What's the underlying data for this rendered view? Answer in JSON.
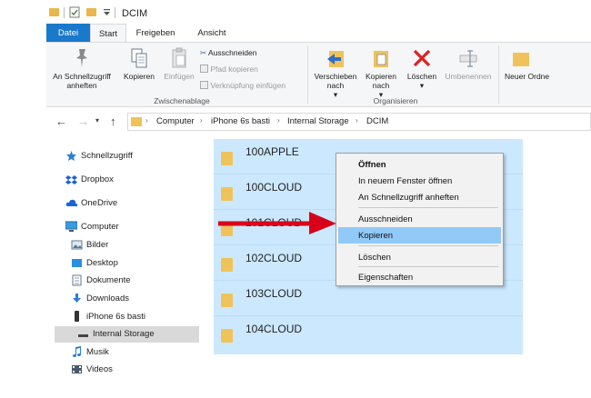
{
  "window": {
    "title": "DCIM"
  },
  "ribbon": {
    "tabs": [
      "Datei",
      "Start",
      "Freigeben",
      "Ansicht"
    ],
    "clipboard": {
      "pin_quick_access": "An Schnellzugriff anheften",
      "copy": "Kopieren",
      "paste": "Einfügen",
      "cut": "Ausschneiden",
      "copy_path": "Pfad kopieren",
      "paste_shortcut": "Verknüpfung einfügen",
      "group_label": "Zwischenablage"
    },
    "organize": {
      "move_to": "Verschieben nach",
      "copy_to": "Kopieren nach",
      "delete": "Löschen",
      "rename": "Umbenennen",
      "group_label": "Organisieren"
    },
    "new": {
      "new_folder": "Neuer Ordne"
    }
  },
  "address": {
    "crumbs": [
      "Computer",
      "iPhone 6s basti",
      "Internal Storage",
      "DCIM"
    ]
  },
  "sidebar": {
    "items": [
      {
        "label": "Schnellzugriff",
        "icon": "star-icon"
      },
      {
        "label": "Dropbox",
        "icon": "dropbox-icon"
      },
      {
        "label": "OneDrive",
        "icon": "cloud-icon"
      },
      {
        "label": "Computer",
        "icon": "monitor-icon"
      },
      {
        "label": "Bilder",
        "icon": "pictures-icon"
      },
      {
        "label": "Desktop",
        "icon": "desktop-icon"
      },
      {
        "label": "Dokumente",
        "icon": "documents-icon"
      },
      {
        "label": "Downloads",
        "icon": "download-icon"
      },
      {
        "label": "iPhone 6s basti",
        "icon": "phone-icon"
      },
      {
        "label": "Internal Storage",
        "icon": "drive-icon"
      },
      {
        "label": "Musik",
        "icon": "music-icon"
      },
      {
        "label": "Videos",
        "icon": "video-icon"
      }
    ]
  },
  "folders": [
    "100APPLE",
    "100CLOUD",
    "101CLOUD",
    "102CLOUD",
    "103CLOUD",
    "104CLOUD"
  ],
  "context_menu": {
    "open": "Öffnen",
    "open_new_window": "In neuem Fenster öffnen",
    "pin_quick_access": "An Schnellzugriff anheften",
    "cut": "Ausschneiden",
    "copy": "Kopieren",
    "delete": "Löschen",
    "properties": "Eigenschaften"
  },
  "colors": {
    "accent": "#1979ca",
    "selection": "#cce8ff",
    "menu_highlight": "#91c9f7",
    "annotation_arrow": "#d9001b",
    "folder": "#efc35a"
  }
}
